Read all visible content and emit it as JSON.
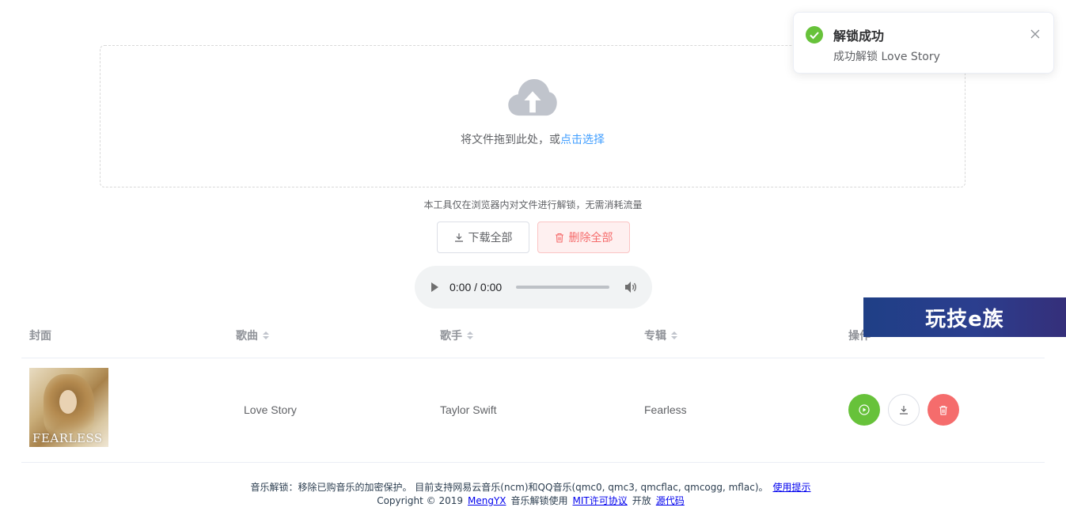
{
  "upload": {
    "prompt": "将文件拖到此处，或",
    "link": "点击选择"
  },
  "tip": "本工具仅在浏览器内对文件进行解锁，无需消耗流量",
  "buttons": {
    "download_all": "下载全部",
    "delete_all": "删除全部"
  },
  "audio": {
    "time": "0:00 / 0:00"
  },
  "table": {
    "headers": {
      "cover": "封面",
      "title": "歌曲",
      "artist": "歌手",
      "album": "专辑",
      "actions": "操作"
    },
    "rows": [
      {
        "cover_text": "FEARLESS",
        "title": "Love Story",
        "artist": "Taylor Swift",
        "album": "Fearless"
      }
    ]
  },
  "footer": {
    "line1": "音乐解锁：移除已购音乐的加密保护。 目前支持网易云音乐(ncm)和QQ音乐(qmc0, qmc3, qmcflac, qmcogg, mflac)。",
    "help_link": "使用提示",
    "copyright": "Copyright © 2019",
    "author_link": "MengYX",
    "mid": "音乐解锁使用",
    "license_link": "MIT许可协议",
    "open": "开放",
    "source_link": "源代码"
  },
  "toast": {
    "title": "解锁成功",
    "message": "成功解锁 Love Story"
  },
  "watermark": "玩技e族",
  "colors": {
    "primary": "#409eff",
    "success": "#67c23a",
    "danger": "#f56c6c"
  }
}
